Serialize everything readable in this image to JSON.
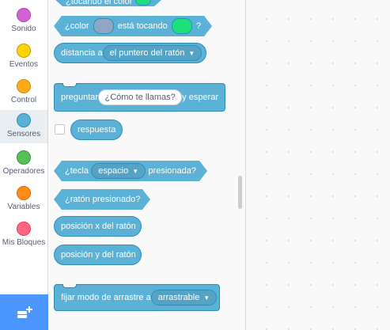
{
  "categories": [
    {
      "label": "Sonido",
      "color": "#cf63cf",
      "border": "#bd42bd"
    },
    {
      "label": "Eventos",
      "color": "#ffd500",
      "border": "#cc9900"
    },
    {
      "label": "Control",
      "color": "#ffab19",
      "border": "#cf8b17"
    },
    {
      "label": "Sensores",
      "color": "#5cb1d6",
      "border": "#2e8eb8",
      "selected": true
    },
    {
      "label": "Operadores",
      "color": "#59c059",
      "border": "#389438"
    },
    {
      "label": "Variables",
      "color": "#ff8c1a",
      "border": "#db6e00"
    },
    {
      "label": "Mis Bloques",
      "color": "#ff6680",
      "border": "#ff3355"
    }
  ],
  "colors": {
    "sensing": "#5cb1d6",
    "sensing_border": "#2e8eb8",
    "swatch_gray": "#8fa7c4",
    "swatch_green": "#1ce07a",
    "extension_button": "#4c97ff"
  },
  "blocks": {
    "touching_color_partial": {
      "label": "¿tocando el color"
    },
    "color_touching": {
      "part1": "¿color",
      "part2": "está tocando",
      "part3": "?"
    },
    "distance_to": {
      "label": "distancia a",
      "dropdown": "el puntero del ratón"
    },
    "ask_wait": {
      "label": "preguntar",
      "input": "¿Cómo te llamas?",
      "suffix": "y esperar"
    },
    "answer": {
      "label": "respuesta"
    },
    "key_pressed": {
      "label": "¿tecla",
      "dropdown": "espacio",
      "suffix": "presionada?"
    },
    "mouse_down": {
      "label": "¿ratón presionado?"
    },
    "mouse_x": {
      "label": "posición x del ratón"
    },
    "mouse_y": {
      "label": "posición y del ratón"
    },
    "drag_mode": {
      "label": "fijar modo de arrastre a",
      "dropdown": "arrastrable"
    }
  }
}
